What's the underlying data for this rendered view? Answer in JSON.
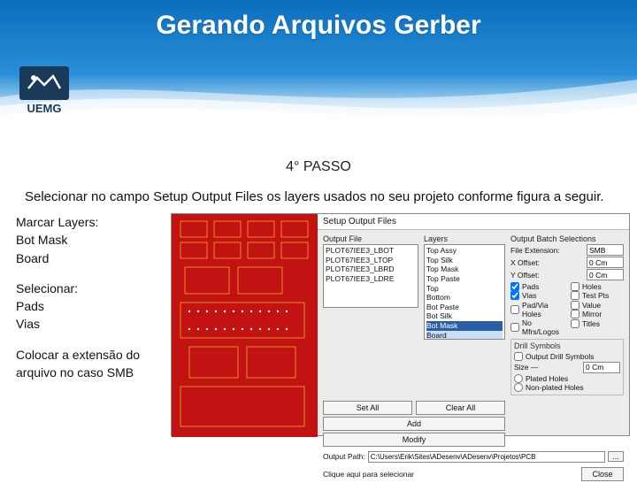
{
  "banner": {
    "title": "Gerando Arquivos Gerber",
    "logo_text": "UEMG"
  },
  "step": "4° PASSO",
  "description": "Selecionar no campo Setup Output Files os layers usados no seu projeto conforme figura a seguir.",
  "notes": {
    "marcar_h": "Marcar Layers:",
    "marcar_1": "Bot Mask",
    "marcar_2": "Board",
    "sel_h": "Selecionar:",
    "sel_1": "Pads",
    "sel_2": "Vias",
    "ext_h": "Colocar a extensão do arquivo no caso SMB"
  },
  "dialog": {
    "title": "Setup Output Files",
    "output_file_label": "Output File",
    "output_files": [
      "PLOT67IEE3_LBOT",
      "PLOT67IEE3_LTOP",
      "PLOT67IEE3_LBRD",
      "PLOT67IEE3_LDRE"
    ],
    "layers_label": "Layers",
    "layers": [
      "Top Assy",
      "Top Silk",
      "Top Mask",
      "Top Paste",
      "Top",
      "Bottom",
      "Bot Paste",
      "Bot Silk",
      "Bot Mask",
      "Board"
    ],
    "batch_label": "Output Batch Selections",
    "ext_label": "File Extension:",
    "ext_value": "SMB",
    "xoff_label": "X Offset:",
    "xoff_value": "0 Cm",
    "yoff_label": "Y Offset:",
    "yoff_value": "0 Cm",
    "opts_left": [
      "Pads",
      "Vias",
      "Pad/Via Holes",
      "No Mfrs/Logos"
    ],
    "opts_left_checked": [
      true,
      true,
      false,
      false
    ],
    "opts_right": [
      "Holes",
      "Test Pts",
      "Value",
      "Mirror",
      "Titles"
    ],
    "opts_right_checked": [
      false,
      false,
      false,
      false,
      false
    ],
    "drill_label": "Drill Symbols",
    "drill_opts": [
      "Output Drill Symbols"
    ],
    "size_label": "Size —",
    "size_value": "0 Cm",
    "hole_opts": [
      "Plated Holes",
      "Non-plated Holes"
    ],
    "btn_set_all": "Set All",
    "btn_clear_all": "Clear All",
    "btn_add": "Add",
    "btn_modify": "Modify",
    "out_path_label": "Output Path:",
    "out_path_value": "C:\\Users\\Erik\\Sites\\ADesenv\\ADesenv\\Projetos\\PCB",
    "foot_note": "Clique aqui para selecionar",
    "btn_close": "Close",
    "browse": "..."
  }
}
